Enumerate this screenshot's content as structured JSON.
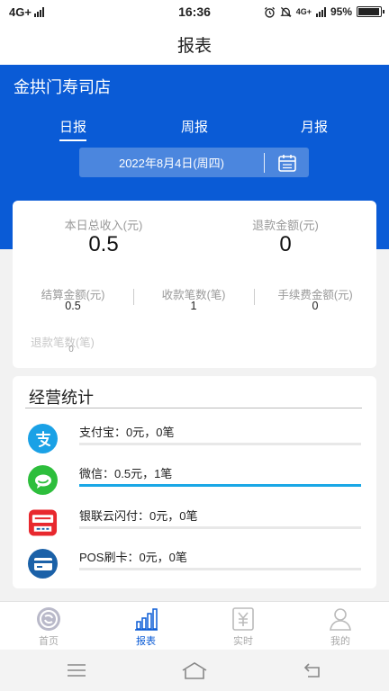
{
  "status_bar": {
    "network": "4G+",
    "time": "16:36",
    "network_right": "4G+",
    "battery": "95%",
    "battery_level": 0.95
  },
  "header": {
    "title": "报表"
  },
  "store": {
    "name": "金拱门寿司店"
  },
  "period_tabs": [
    {
      "label": "日报",
      "active": true
    },
    {
      "label": "周报",
      "active": false
    },
    {
      "label": "月报",
      "active": false
    }
  ],
  "date_picker": {
    "value": "2022年8月4日(周四)",
    "icon": "calendar-icon"
  },
  "summary": {
    "income_label": "本日总收入(元)",
    "income_value": "0.5",
    "refund_label": "退款金额(元)",
    "refund_value": "0",
    "settlement_label": "结算金额(元)",
    "settlement_value": "0.5",
    "count_label": "收款笔数(笔)",
    "count_value": "1",
    "fee_label": "手续费金额(元)",
    "fee_value": "0",
    "refund_count_label": "退款笔数(笔)",
    "refund_count_value": "0"
  },
  "operations": {
    "title": "经营统计",
    "items": [
      {
        "label": "支付宝：0元，0笔",
        "icon": "alipay-icon",
        "color": "#1aa1e6",
        "share": 0
      },
      {
        "label": "微信：0.5元，1笔",
        "icon": "wechat-icon",
        "color": "#2dbe3c",
        "share": 1
      },
      {
        "label": "银联云闪付：0元，0笔",
        "icon": "unionpay-icon",
        "color": "#e8282e",
        "share": 0
      },
      {
        "label": "POS刷卡：0元，0笔",
        "icon": "pos-card-icon",
        "color": "#1b61a8",
        "share": 0
      }
    ]
  },
  "bottom_nav": [
    {
      "label": "首页",
      "icon": "home-icon",
      "active": false
    },
    {
      "label": "报表",
      "icon": "report-icon",
      "active": true
    },
    {
      "label": "实时",
      "icon": "realtime-icon",
      "active": false
    },
    {
      "label": "我的",
      "icon": "profile-icon",
      "active": false
    }
  ],
  "colors": {
    "brand": "#0a5bd6",
    "progress": "#19a7e6"
  }
}
